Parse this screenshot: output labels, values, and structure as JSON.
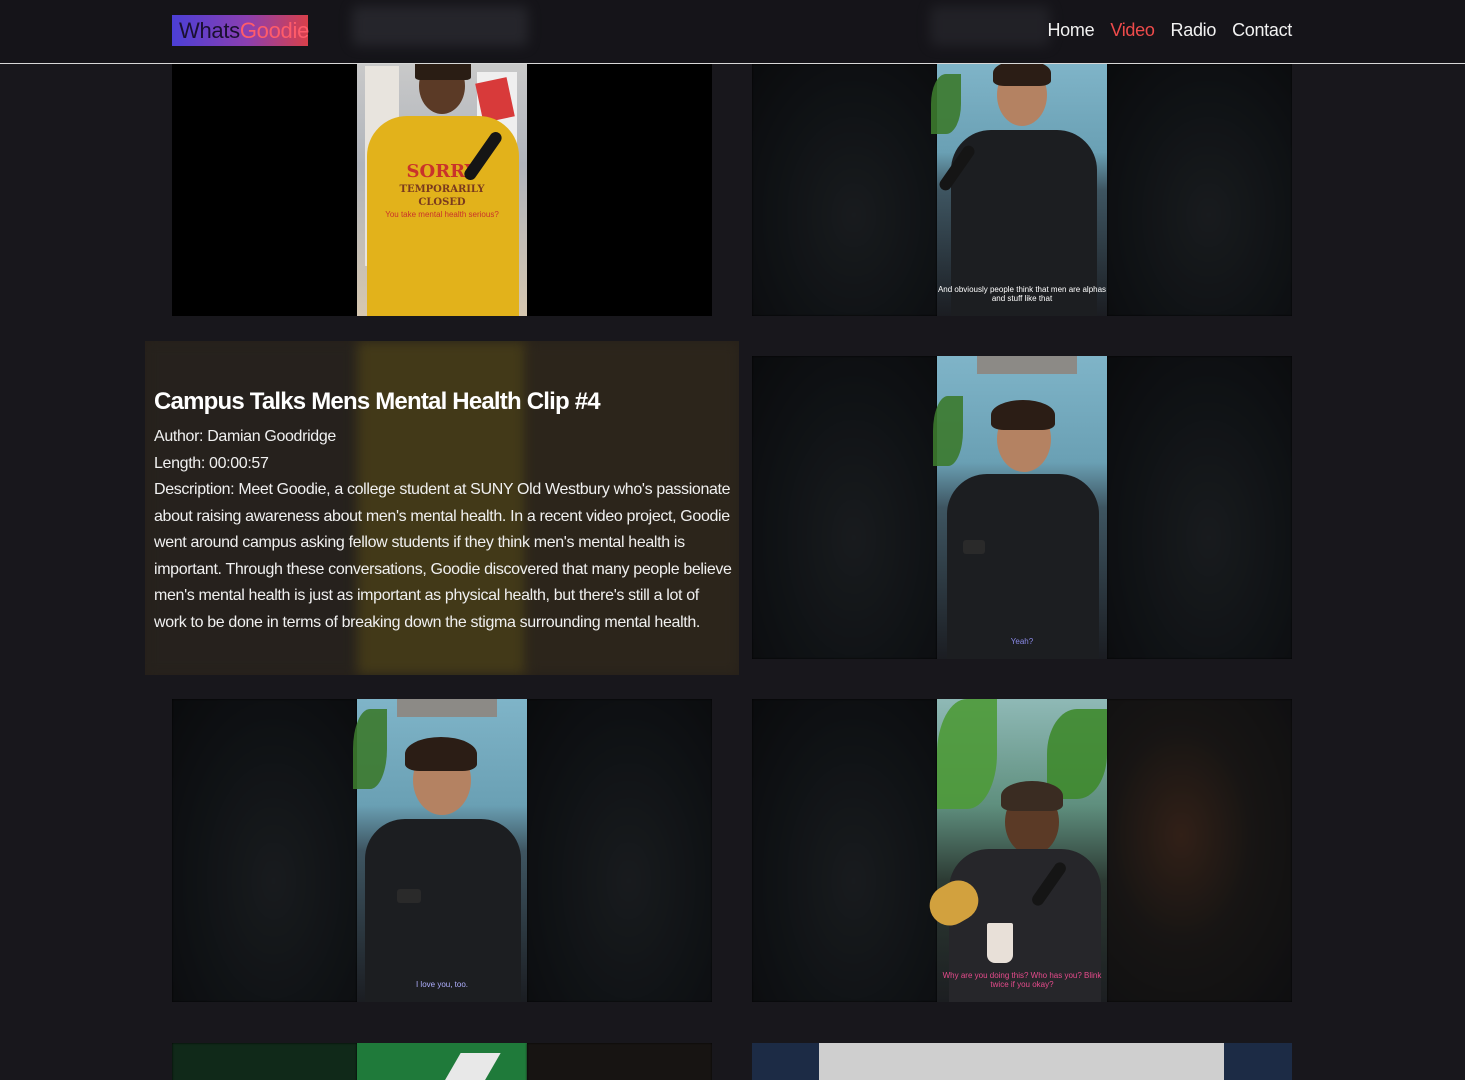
{
  "header": {
    "logo": {
      "part1": "Whats",
      "part2": "Goodie"
    },
    "nav": [
      {
        "label": "Home",
        "active": false
      },
      {
        "label": "Video",
        "active": true
      },
      {
        "label": "Radio",
        "active": false
      },
      {
        "label": "Contact",
        "active": false
      }
    ]
  },
  "colors": {
    "accent": "#ee4b4b",
    "background": "#18171c",
    "logo_gradient": [
      "#4b3fd6",
      "#d8404a"
    ]
  },
  "videos": [
    {
      "id": "clip-1",
      "caption": "",
      "shirt_text": {
        "line1": "SORRY",
        "line2": "TEMPORARILY",
        "line3": "CLOSED",
        "line4": "You take mental health serious?"
      }
    },
    {
      "id": "clip-2",
      "caption": "And obviously people think that men are alphas and stuff like that"
    },
    {
      "id": "clip-3",
      "caption": "Yeah?"
    },
    {
      "id": "clip-4",
      "caption": "I love you, too."
    },
    {
      "id": "clip-5",
      "caption": "Why are you doing this?  Who has you? Blink twice if you okay?"
    }
  ],
  "featured": {
    "title": "Campus Talks Mens Mental Health Clip #4",
    "author": "Author: Damian Goodridge",
    "length": "Length: 00:00:57",
    "description": "Description: Meet Goodie, a college student at SUNY Old Westbury who's passionate about raising awareness about men's mental health. In a recent video project, Goodie went around campus asking fellow students if they think men's mental health is important. Through these conversations, Goodie discovered that many people believe men's mental health is just as important as physical health, but there's still a lot of work to be done in terms of breaking down the stigma surrounding mental health."
  }
}
